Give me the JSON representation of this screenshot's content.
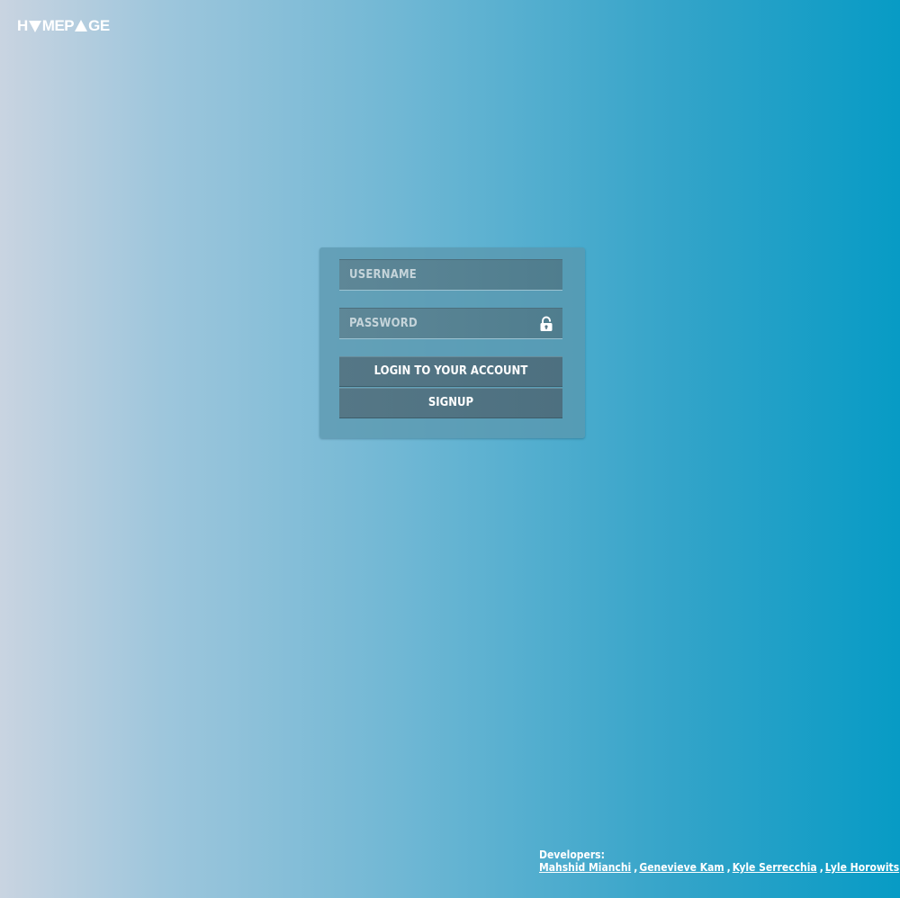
{
  "logo": {
    "part1": "H",
    "part2": "MEP",
    "part3": "GE"
  },
  "login_form": {
    "username_placeholder": "USERNAME",
    "username_value": "",
    "password_placeholder": "PASSWORD",
    "password_value": "",
    "password_icon": "lock-icon",
    "login_button_label": "LOGIN TO YOUR ACCOUNT",
    "signup_button_label": "SIGNUP"
  },
  "footer": {
    "developers_label": "Developers:",
    "developers": [
      "Mahshid Mianchi",
      "Genevieve Kam",
      "Kyle Serrecchia",
      "Lyle Horowits"
    ],
    "separator": ","
  },
  "colors": {
    "background_left": "#c9d4e1",
    "background_right": "#079bc5",
    "panel": "#5a96ac",
    "button": "#557786",
    "text": "#ffffff"
  }
}
